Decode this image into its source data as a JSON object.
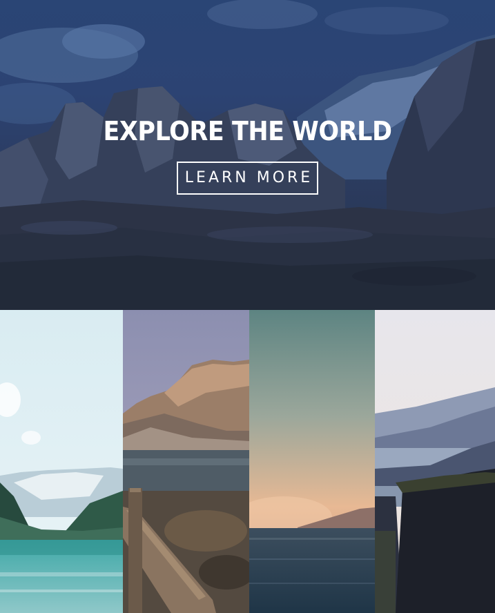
{
  "hero": {
    "title": "EXPLORE THE WORLD",
    "button_label": "LEARN MORE",
    "overlay_color": "#2c4373"
  },
  "gallery": {
    "panels": [
      {
        "name": "lake-valley-photo"
      },
      {
        "name": "mountain-lake-dock-photo"
      },
      {
        "name": "misty-sunset-lake-photo"
      },
      {
        "name": "river-gorge-cliff-photo"
      }
    ]
  }
}
